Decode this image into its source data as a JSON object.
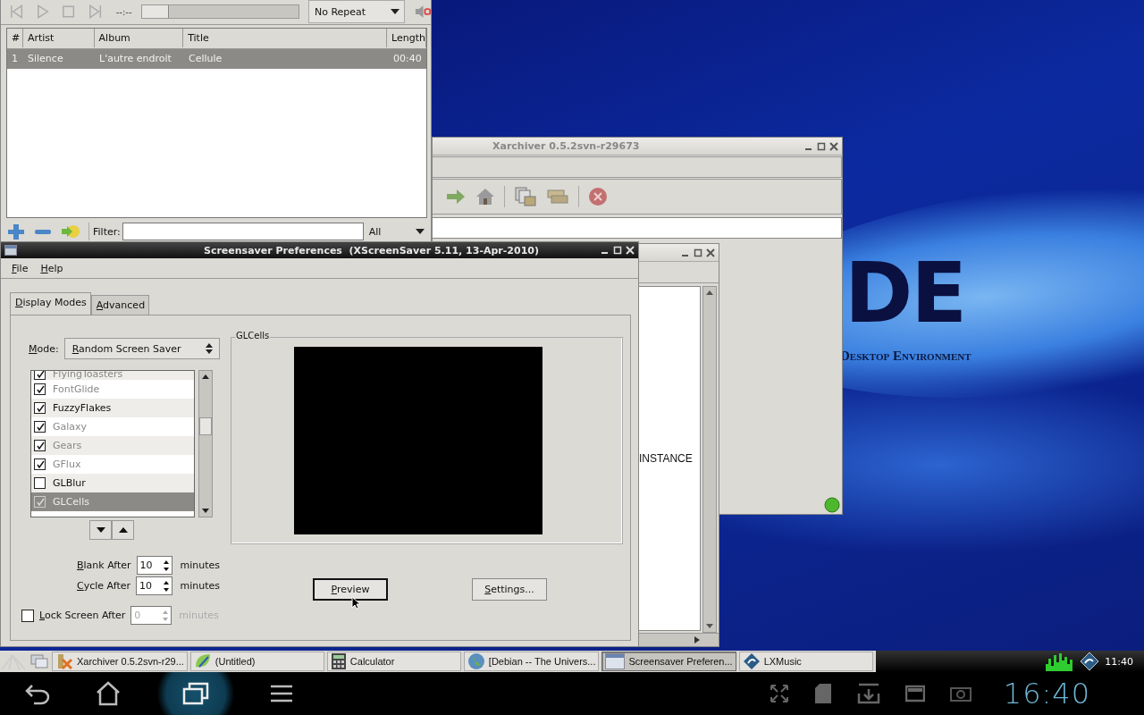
{
  "wallpaper": {
    "logo": "DE",
    "tagline": "Desktop Environment"
  },
  "music_player": {
    "time": "--:--",
    "seek": {
      "level": 0
    },
    "repeat": "No Repeat",
    "columns": [
      "#",
      "Artist",
      "Album",
      "Title",
      "Length"
    ],
    "rows": [
      {
        "cells": [
          "1",
          "Silence",
          "L'autre endroit",
          "Cellule",
          "00:40"
        ],
        "selected": true
      }
    ],
    "filter_label": "Filter:",
    "filter_option": "All"
  },
  "xarchiver": {
    "title": "Xarchiver 0.5.2svn-r29673"
  },
  "back_window": {
    "text": "INSTANCE"
  },
  "screensaver": {
    "title": "Screensaver Preferences  (XScreenSaver 5.11, 13-Apr-2010)",
    "menu": [
      "File",
      "Help"
    ],
    "tabs": [
      {
        "label": "Display Modes",
        "selected": true
      },
      {
        "label": "Advanced",
        "selected": false
      }
    ],
    "mode_label": "Mode:",
    "mode": "Random Screen Saver",
    "savers": [
      {
        "name": "FlyingToasters",
        "checked": true,
        "disabled": true,
        "selected": false
      },
      {
        "name": "FontGlide",
        "checked": true,
        "disabled": true,
        "selected": false
      },
      {
        "name": "FuzzyFlakes",
        "checked": true,
        "disabled": false,
        "selected": false
      },
      {
        "name": "Galaxy",
        "checked": true,
        "disabled": true,
        "selected": false
      },
      {
        "name": "Gears",
        "checked": true,
        "disabled": true,
        "selected": false
      },
      {
        "name": "GFlux",
        "checked": true,
        "disabled": true,
        "selected": false
      },
      {
        "name": "GLBlur",
        "checked": false,
        "disabled": false,
        "selected": false
      },
      {
        "name": "GLCells",
        "checked": true,
        "disabled": true,
        "selected": true
      }
    ],
    "preview_frame": "GLCells",
    "timers": [
      {
        "label": "Blank After",
        "value": "10",
        "unit": "minutes"
      },
      {
        "label": "Cycle After",
        "value": "10",
        "unit": "minutes"
      }
    ],
    "lock": {
      "label": "Lock Screen After",
      "checked": false,
      "value": "0",
      "unit": "minutes",
      "disabled": true
    },
    "buttons": [
      "Preview",
      "Settings..."
    ]
  },
  "taskbar": {
    "tasks": [
      {
        "label": "Xarchiver 0.5.2svn-r29...",
        "selected": false,
        "kind": "archive"
      },
      {
        "label": "(Untitled)",
        "selected": false,
        "kind": "editor"
      },
      {
        "label": "Calculator",
        "selected": false,
        "kind": "calculator"
      },
      {
        "label": "[Debian -- The Univers...",
        "selected": false,
        "kind": "browser"
      },
      {
        "label": "Screensaver Preferen...",
        "selected": true,
        "kind": "window"
      },
      {
        "label": "LXMusic",
        "selected": false,
        "kind": "music"
      }
    ],
    "clock": "11:40"
  },
  "system_bar": {
    "clock": "16:40"
  }
}
